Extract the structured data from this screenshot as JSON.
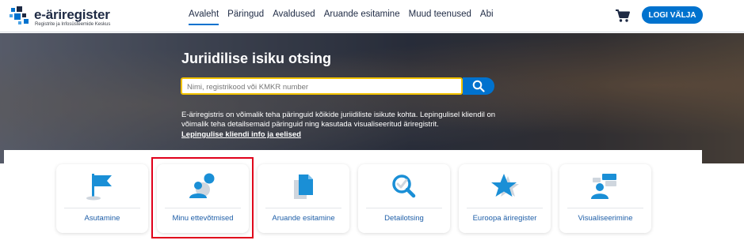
{
  "header": {
    "logo_title": "e-äriregister",
    "logo_subtitle": "Registrite ja Infosüsteemide Keskus",
    "nav": [
      {
        "label": "Avaleht",
        "active": true
      },
      {
        "label": "Päringud",
        "active": false
      },
      {
        "label": "Avaldused",
        "active": false
      },
      {
        "label": "Aruande esitamine",
        "active": false
      },
      {
        "label": "Muud teenused",
        "active": false
      },
      {
        "label": "Abi",
        "active": false
      }
    ],
    "cart_icon": "cart-icon",
    "login_label": "LOGI VÄLJA"
  },
  "hero": {
    "title": "Juriidilise isiku otsing",
    "search_placeholder": "Nimi, registrikood või KMKR number",
    "search_icon": "search-icon",
    "description": "E-äriregistris on võimalik teha päringuid kõikide juriidiliste isikute kohta. Lepingulisel kliendil on võimalik teha detailsemaid päringuid ning kasutada visualiseeritud äriregistrit.",
    "link": "Lepingulise kliendi info ja eelised"
  },
  "cards": [
    {
      "label": "Asutamine",
      "icon": "flag-icon"
    },
    {
      "label": "Minu ettevõtmised",
      "icon": "user-bubble-icon"
    },
    {
      "label": "Aruande esitamine",
      "icon": "documents-icon"
    },
    {
      "label": "Detailotsing",
      "icon": "magnifier-check-icon"
    },
    {
      "label": "Euroopa äriregister",
      "icon": "star-icon"
    },
    {
      "label": "Visualiseerimine",
      "icon": "user-chat-icon"
    }
  ],
  "colors": {
    "brand_blue": "#0072ce",
    "navy": "#1e2a44",
    "search_border": "#f2c200",
    "highlight": "#e0001b",
    "icon_blue": "#1a8fd6"
  }
}
